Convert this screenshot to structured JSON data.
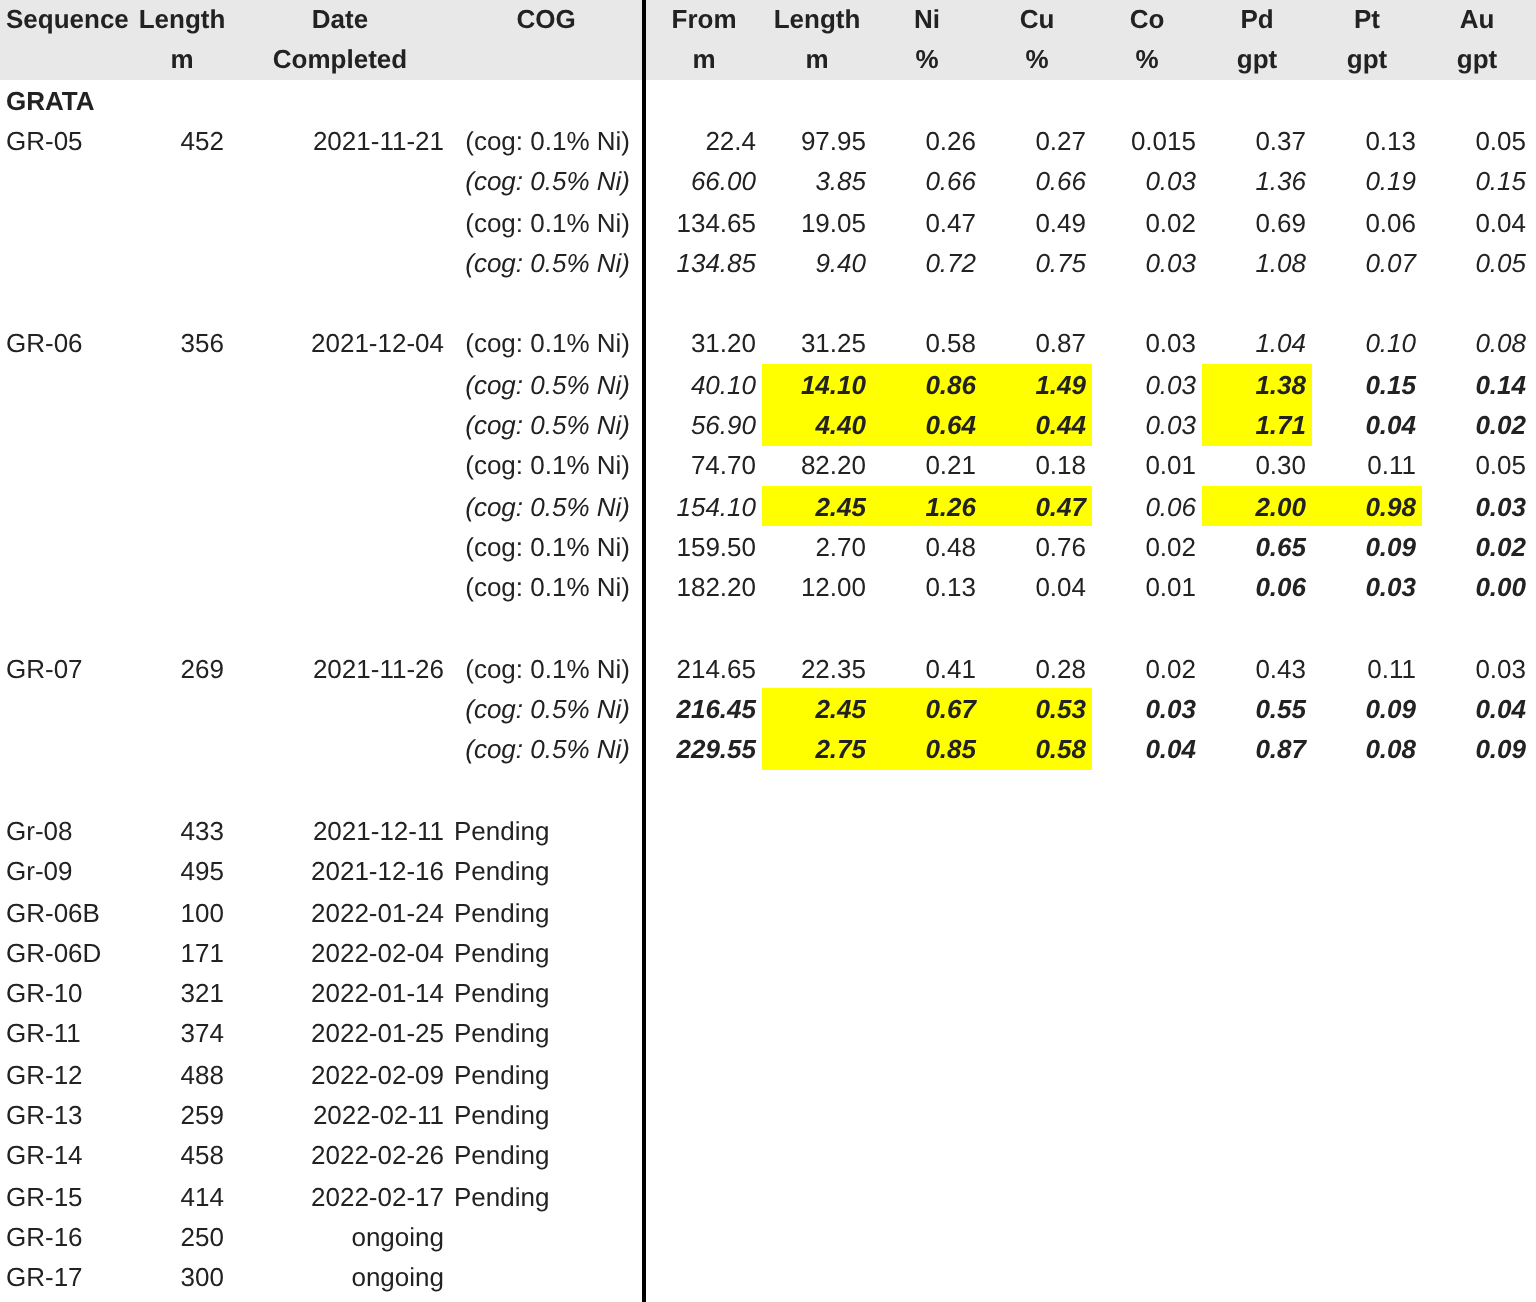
{
  "left_columns": [
    {
      "lines": [
        "Sequence"
      ]
    },
    {
      "lines": [
        "Length",
        "m"
      ]
    },
    {
      "lines": [
        "Date",
        "Completed"
      ]
    },
    {
      "lines": [
        "COG"
      ]
    }
  ],
  "right_columns": [
    {
      "lines": [
        "From",
        "m"
      ]
    },
    {
      "lines": [
        "Length",
        "m"
      ]
    },
    {
      "lines": [
        "Ni",
        "%"
      ]
    },
    {
      "lines": [
        "Cu",
        "%"
      ]
    },
    {
      "lines": [
        "Co",
        "%"
      ]
    },
    {
      "lines": [
        "Pd",
        "gpt"
      ]
    },
    {
      "lines": [
        "Pt",
        "gpt"
      ]
    },
    {
      "lines": [
        "Au",
        "gpt"
      ]
    }
  ],
  "section": "GRATA",
  "holes": [
    {
      "sequence": "GR-05",
      "length": "452",
      "date": "2021-11-21",
      "intervals": [
        {
          "cog": "(cog: 0.1% Ni)",
          "kind": "plain",
          "cells": [
            {
              "v": "22.4",
              "kind": "plain",
              "highlight": false
            },
            {
              "v": "97.95",
              "kind": "plain",
              "highlight": false
            },
            {
              "v": "0.26",
              "kind": "plain",
              "highlight": false
            },
            {
              "v": "0.27",
              "kind": "plain",
              "highlight": false
            },
            {
              "v": "0.015",
              "kind": "plain",
              "highlight": false
            },
            {
              "v": "0.37",
              "kind": "plain",
              "highlight": false
            },
            {
              "v": "0.13",
              "kind": "plain",
              "highlight": false
            },
            {
              "v": "0.05",
              "kind": "plain",
              "highlight": false
            }
          ]
        },
        {
          "cog": "(cog: 0.5% Ni)",
          "kind": "italic",
          "cells": [
            {
              "v": "66.00",
              "kind": "italic",
              "highlight": false
            },
            {
              "v": "3.85",
              "kind": "italic",
              "highlight": false
            },
            {
              "v": "0.66",
              "kind": "italic",
              "highlight": false
            },
            {
              "v": "0.66",
              "kind": "italic",
              "highlight": false
            },
            {
              "v": "0.03",
              "kind": "italic",
              "highlight": false
            },
            {
              "v": "1.36",
              "kind": "italic",
              "highlight": false
            },
            {
              "v": "0.19",
              "kind": "italic",
              "highlight": false
            },
            {
              "v": "0.15",
              "kind": "italic",
              "highlight": false
            }
          ]
        },
        {
          "cog": "(cog: 0.1% Ni)",
          "kind": "plain",
          "cells": [
            {
              "v": "134.65",
              "kind": "plain",
              "highlight": false
            },
            {
              "v": "19.05",
              "kind": "plain",
              "highlight": false
            },
            {
              "v": "0.47",
              "kind": "plain",
              "highlight": false
            },
            {
              "v": "0.49",
              "kind": "plain",
              "highlight": false
            },
            {
              "v": "0.02",
              "kind": "plain",
              "highlight": false
            },
            {
              "v": "0.69",
              "kind": "plain",
              "highlight": false
            },
            {
              "v": "0.06",
              "kind": "plain",
              "highlight": false
            },
            {
              "v": "0.04",
              "kind": "plain",
              "highlight": false
            }
          ]
        },
        {
          "cog": "(cog: 0.5% Ni)",
          "kind": "italic",
          "cells": [
            {
              "v": "134.85",
              "kind": "italic",
              "highlight": false
            },
            {
              "v": "9.40",
              "kind": "italic",
              "highlight": false
            },
            {
              "v": "0.72",
              "kind": "italic",
              "highlight": false
            },
            {
              "v": "0.75",
              "kind": "italic",
              "highlight": false
            },
            {
              "v": "0.03",
              "kind": "italic",
              "highlight": false
            },
            {
              "v": "1.08",
              "kind": "italic",
              "highlight": false
            },
            {
              "v": "0.07",
              "kind": "italic",
              "highlight": false
            },
            {
              "v": "0.05",
              "kind": "italic",
              "highlight": false
            }
          ]
        }
      ]
    },
    {
      "sequence": "GR-06",
      "length": "356",
      "date": "2021-12-04",
      "intervals": [
        {
          "cog": "(cog: 0.1% Ni)",
          "kind": "plain",
          "cells": [
            {
              "v": "31.20",
              "kind": "plain",
              "highlight": false
            },
            {
              "v": "31.25",
              "kind": "plain",
              "highlight": false
            },
            {
              "v": "0.58",
              "kind": "plain",
              "highlight": false
            },
            {
              "v": "0.87",
              "kind": "plain",
              "highlight": false
            },
            {
              "v": "0.03",
              "kind": "plain",
              "highlight": false
            },
            {
              "v": "1.04",
              "kind": "italic",
              "highlight": false
            },
            {
              "v": "0.10",
              "kind": "italic",
              "highlight": false
            },
            {
              "v": "0.08",
              "kind": "italic",
              "highlight": false
            }
          ]
        },
        {
          "cog": "(cog: 0.5% Ni)",
          "kind": "italic",
          "cells": [
            {
              "v": "40.10",
              "kind": "italic",
              "highlight": false
            },
            {
              "v": "14.10",
              "kind": "bold",
              "highlight": true
            },
            {
              "v": "0.86",
              "kind": "bold",
              "highlight": true
            },
            {
              "v": "1.49",
              "kind": "bold",
              "highlight": true
            },
            {
              "v": "0.03",
              "kind": "italic",
              "highlight": false
            },
            {
              "v": "1.38",
              "kind": "bold",
              "highlight": true
            },
            {
              "v": "0.15",
              "kind": "bold",
              "highlight": false
            },
            {
              "v": "0.14",
              "kind": "bold",
              "highlight": false
            }
          ]
        },
        {
          "cog": "(cog: 0.5% Ni)",
          "kind": "italic",
          "cells": [
            {
              "v": "56.90",
              "kind": "italic",
              "highlight": false
            },
            {
              "v": "4.40",
              "kind": "bold",
              "highlight": true
            },
            {
              "v": "0.64",
              "kind": "bold",
              "highlight": true
            },
            {
              "v": "0.44",
              "kind": "bold",
              "highlight": true
            },
            {
              "v": "0.03",
              "kind": "italic",
              "highlight": false
            },
            {
              "v": "1.71",
              "kind": "bold",
              "highlight": true
            },
            {
              "v": "0.04",
              "kind": "bold",
              "highlight": false
            },
            {
              "v": "0.02",
              "kind": "bold",
              "highlight": false
            }
          ]
        },
        {
          "cog": "(cog: 0.1% Ni)",
          "kind": "plain",
          "cells": [
            {
              "v": "74.70",
              "kind": "plain",
              "highlight": false
            },
            {
              "v": "82.20",
              "kind": "plain",
              "highlight": false
            },
            {
              "v": "0.21",
              "kind": "plain",
              "highlight": false
            },
            {
              "v": "0.18",
              "kind": "plain",
              "highlight": false
            },
            {
              "v": "0.01",
              "kind": "plain",
              "highlight": false
            },
            {
              "v": "0.30",
              "kind": "plain",
              "highlight": false
            },
            {
              "v": "0.11",
              "kind": "plain",
              "highlight": false
            },
            {
              "v": "0.05",
              "kind": "plain",
              "highlight": false
            }
          ]
        },
        {
          "cog": "(cog: 0.5% Ni)",
          "kind": "italic",
          "cells": [
            {
              "v": "154.10",
              "kind": "italic",
              "highlight": false
            },
            {
              "v": "2.45",
              "kind": "bold",
              "highlight": true
            },
            {
              "v": "1.26",
              "kind": "bold",
              "highlight": true
            },
            {
              "v": "0.47",
              "kind": "bold",
              "highlight": true
            },
            {
              "v": "0.06",
              "kind": "italic",
              "highlight": false
            },
            {
              "v": "2.00",
              "kind": "bold",
              "highlight": true
            },
            {
              "v": "0.98",
              "kind": "bold",
              "highlight": true
            },
            {
              "v": "0.03",
              "kind": "bold",
              "highlight": false
            }
          ]
        },
        {
          "cog": "(cog: 0.1% Ni)",
          "kind": "plain",
          "cells": [
            {
              "v": "159.50",
              "kind": "plain",
              "highlight": false
            },
            {
              "v": "2.70",
              "kind": "plain",
              "highlight": false
            },
            {
              "v": "0.48",
              "kind": "plain",
              "highlight": false
            },
            {
              "v": "0.76",
              "kind": "plain",
              "highlight": false
            },
            {
              "v": "0.02",
              "kind": "plain",
              "highlight": false
            },
            {
              "v": "0.65",
              "kind": "bold",
              "highlight": false
            },
            {
              "v": "0.09",
              "kind": "bold",
              "highlight": false
            },
            {
              "v": "0.02",
              "kind": "bold",
              "highlight": false
            }
          ]
        },
        {
          "cog": "(cog: 0.1% Ni)",
          "kind": "plain",
          "cells": [
            {
              "v": "182.20",
              "kind": "plain",
              "highlight": false
            },
            {
              "v": "12.00",
              "kind": "plain",
              "highlight": false
            },
            {
              "v": "0.13",
              "kind": "plain",
              "highlight": false
            },
            {
              "v": "0.04",
              "kind": "plain",
              "highlight": false
            },
            {
              "v": "0.01",
              "kind": "plain",
              "highlight": false
            },
            {
              "v": "0.06",
              "kind": "bold",
              "highlight": false
            },
            {
              "v": "0.03",
              "kind": "bold",
              "highlight": false
            },
            {
              "v": "0.00",
              "kind": "bold",
              "highlight": false
            }
          ]
        }
      ]
    },
    {
      "sequence": "GR-07",
      "length": "269",
      "date": "2021-11-26",
      "intervals": [
        {
          "cog": "(cog: 0.1% Ni)",
          "kind": "plain",
          "cells": [
            {
              "v": "214.65",
              "kind": "plain",
              "highlight": false
            },
            {
              "v": "22.35",
              "kind": "plain",
              "highlight": false
            },
            {
              "v": "0.41",
              "kind": "plain",
              "highlight": false
            },
            {
              "v": "0.28",
              "kind": "plain",
              "highlight": false
            },
            {
              "v": "0.02",
              "kind": "plain",
              "highlight": false
            },
            {
              "v": "0.43",
              "kind": "plain",
              "highlight": false
            },
            {
              "v": "0.11",
              "kind": "plain",
              "highlight": false
            },
            {
              "v": "0.03",
              "kind": "plain",
              "highlight": false
            }
          ]
        },
        {
          "cog": "(cog: 0.5% Ni)",
          "kind": "italic",
          "cells": [
            {
              "v": "216.45",
              "kind": "bold",
              "highlight": false
            },
            {
              "v": "2.45",
              "kind": "bold",
              "highlight": true
            },
            {
              "v": "0.67",
              "kind": "bold",
              "highlight": true
            },
            {
              "v": "0.53",
              "kind": "bold",
              "highlight": true
            },
            {
              "v": "0.03",
              "kind": "bold",
              "highlight": false
            },
            {
              "v": "0.55",
              "kind": "bold",
              "highlight": false
            },
            {
              "v": "0.09",
              "kind": "bold",
              "highlight": false
            },
            {
              "v": "0.04",
              "kind": "bold",
              "highlight": false
            }
          ]
        },
        {
          "cog": "(cog: 0.5% Ni)",
          "kind": "italic",
          "cells": [
            {
              "v": "229.55",
              "kind": "bold",
              "highlight": false
            },
            {
              "v": "2.75",
              "kind": "bold",
              "highlight": true
            },
            {
              "v": "0.85",
              "kind": "bold",
              "highlight": true
            },
            {
              "v": "0.58",
              "kind": "bold",
              "highlight": true
            },
            {
              "v": "0.04",
              "kind": "bold",
              "highlight": false
            },
            {
              "v": "0.87",
              "kind": "bold",
              "highlight": false
            },
            {
              "v": "0.08",
              "kind": "bold",
              "highlight": false
            },
            {
              "v": "0.09",
              "kind": "bold",
              "highlight": false
            }
          ]
        }
      ]
    }
  ],
  "pending": [
    {
      "sequence": "Gr-08",
      "length": "433",
      "date": "2021-12-11",
      "status": "Pending"
    },
    {
      "sequence": "Gr-09",
      "length": "495",
      "date": "2021-12-16",
      "status": "Pending"
    },
    {
      "sequence": "GR-06B",
      "length": "100",
      "date": "2022-01-24",
      "status": "Pending"
    },
    {
      "sequence": "GR-06D",
      "length": "171",
      "date": "2022-02-04",
      "status": "Pending"
    },
    {
      "sequence": "GR-10",
      "length": "321",
      "date": "2022-01-14",
      "status": "Pending"
    },
    {
      "sequence": "GR-11",
      "length": "374",
      "date": "2022-01-25",
      "status": "Pending"
    },
    {
      "sequence": "GR-12",
      "length": "488",
      "date": "2022-02-09",
      "status": "Pending"
    },
    {
      "sequence": "GR-13",
      "length": "259",
      "date": "2022-02-11",
      "status": "Pending"
    },
    {
      "sequence": "GR-14",
      "length": "458",
      "date": "2022-02-26",
      "status": "Pending"
    },
    {
      "sequence": "GR-15",
      "length": "414",
      "date": "2022-02-17",
      "status": "Pending"
    },
    {
      "sequence": "GR-16",
      "length": "250",
      "date": "ongoing"
    },
    {
      "sequence": "GR-17",
      "length": "300",
      "date": "ongoing"
    }
  ]
}
